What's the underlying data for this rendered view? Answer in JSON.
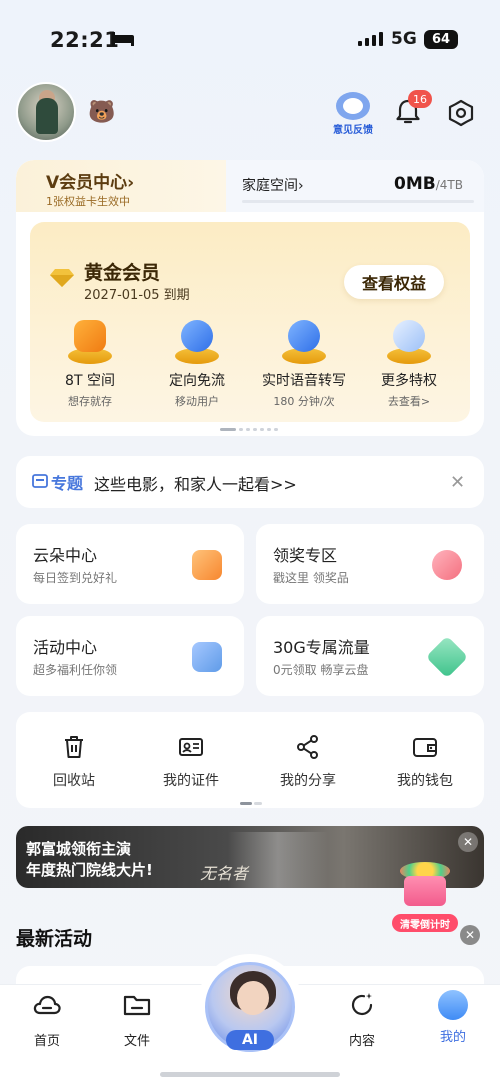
{
  "status_bar": {
    "time": "22:21",
    "network": "5G",
    "battery": "64"
  },
  "header": {
    "feedback_label": "意见反馈",
    "notification_count": "16"
  },
  "membership": {
    "vip_center": "V会员中心",
    "vip_center_arrow": "›",
    "vip_sub": "1张权益卡生效中",
    "family_space": "家庭空间",
    "family_arrow": "›",
    "storage_used": "0MB",
    "storage_total": "/4TB",
    "tier": "黄金会员",
    "expiry": "2027-01-05 到期",
    "view_rights": "查看权益",
    "perks": [
      {
        "title": "8T 空间",
        "sub": "想存就存"
      },
      {
        "title": "定向免流",
        "sub": "移动用户"
      },
      {
        "title": "实时语音转写",
        "sub": "180 分钟/次"
      },
      {
        "title": "更多特权",
        "sub": "去查看>"
      }
    ]
  },
  "topic": {
    "tag": "专题",
    "text": "这些电影，和家人一起看>>",
    "close": "✕"
  },
  "cards": [
    {
      "title": "云朵中心",
      "sub": "每日签到兑好礼",
      "color": "#f7a24a"
    },
    {
      "title": "领奖专区",
      "sub": "戳这里 领奖品",
      "color": "#f77e8c"
    },
    {
      "title": "活动中心",
      "sub": "超多福利任你领",
      "color": "#5f9be8"
    },
    {
      "title": "30G专属流量",
      "sub": "0元领取 畅享云盘",
      "color": "#3cc28a"
    }
  ],
  "tools": [
    {
      "label": "回收站",
      "icon": "trash-icon"
    },
    {
      "label": "我的证件",
      "icon": "id-card-icon"
    },
    {
      "label": "我的分享",
      "icon": "share-icon"
    },
    {
      "label": "我的钱包",
      "icon": "wallet-icon"
    }
  ],
  "banner": {
    "line1": "郭富城领衔主演",
    "line2": "年度热门院线大片!",
    "logo": "无名者",
    "close": "✕",
    "countdown": "清零倒计时",
    "gift_close": "✕"
  },
  "section": {
    "latest_activity": "最新活动"
  },
  "nav": {
    "home": "首页",
    "files": "文件",
    "ai": "AI",
    "content": "内容",
    "mine": "我的"
  },
  "colors": {
    "accent": "#3f6fe0",
    "gold": "#fcecc4",
    "badge": "#f0534b"
  }
}
